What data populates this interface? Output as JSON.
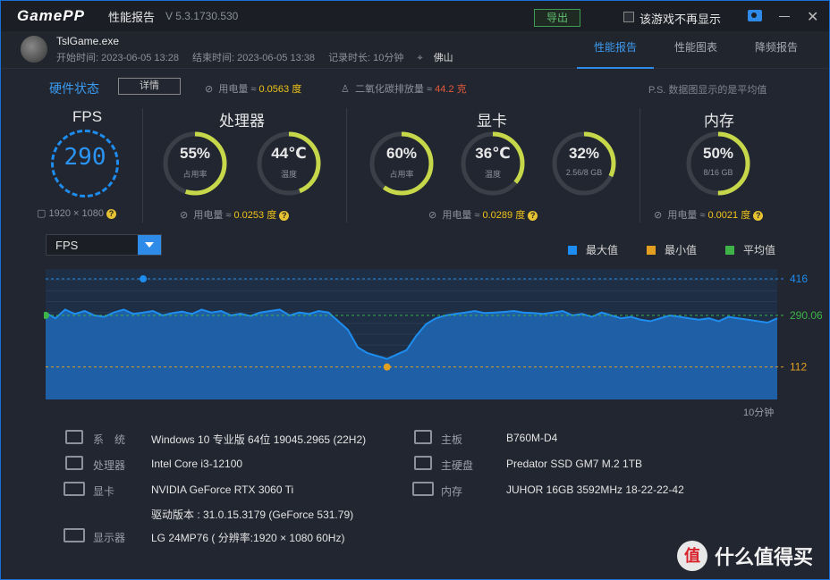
{
  "titlebar": {
    "logo": "GamePP",
    "title": "性能报告",
    "version": "V 5.3.1730.530",
    "export": "导出",
    "no_show": "该游戏不再显示"
  },
  "game": {
    "name": "TslGame.exe",
    "start": "开始时间: 2023-06-05 13:28",
    "end": "结束时间: 2023-06-05 13:38",
    "duration": "记录时长: 10分钟",
    "city": "佛山"
  },
  "tabs": [
    "性能报告",
    "性能图表",
    "降频报告"
  ],
  "hw": {
    "title": "硬件状态",
    "detail": "详情",
    "power": "用电量 ≈",
    "power_val": "0.0563 度",
    "co2": "二氧化碳排放量 ≈",
    "co2_val": "44.2 克",
    "ps": "P.S. 数据图显示的是平均值"
  },
  "fps": {
    "title": "FPS",
    "value": "290",
    "res": "1920 × 1080"
  },
  "cpu": {
    "title": "处理器",
    "usage": "55%",
    "usage_lbl": "占用率",
    "usage_frac": 0.55,
    "temp": "44℃",
    "temp_lbl": "温度",
    "temp_frac": 0.44,
    "power_lbl": "用电量 ≈",
    "power": "0.0253 度"
  },
  "gpu": {
    "title": "显卡",
    "usage": "60%",
    "usage_lbl": "占用率",
    "usage_frac": 0.6,
    "temp": "36℃",
    "temp_lbl": "温度",
    "temp_frac": 0.36,
    "vram": "32%",
    "vram_lbl": "2.56/8 GB",
    "vram_frac": 0.32,
    "power_lbl": "用电量 ≈",
    "power": "0.0289 度"
  },
  "mem": {
    "title": "内存",
    "usage": "50%",
    "usage_lbl": "8/16 GB",
    "usage_frac": 0.5,
    "power_lbl": "用电量 ≈",
    "power": "0.0021 度"
  },
  "chart": {
    "select": "FPS",
    "legend_max": "最大值",
    "legend_min": "最小值",
    "legend_avg": "平均值",
    "xlabel": "10分钟"
  },
  "chart_data": {
    "type": "area",
    "series": [
      {
        "name": "FPS",
        "values": [
          300,
          280,
          310,
          295,
          305,
          290,
          285,
          300,
          310,
          295,
          300,
          305,
          290,
          298,
          303,
          295,
          310,
          300,
          305,
          290,
          296,
          288,
          300,
          305,
          310,
          290,
          300,
          295,
          305,
          300,
          270,
          240,
          180,
          160,
          150,
          140,
          155,
          170,
          220,
          260,
          280,
          290,
          295,
          300,
          305,
          298,
          300,
          302,
          305,
          300,
          298,
          295,
          300,
          305,
          290,
          295,
          285,
          300,
          290,
          280,
          285,
          275,
          270,
          280,
          290,
          285,
          280,
          275,
          280,
          270,
          285,
          280,
          275,
          270,
          265,
          280
        ]
      }
    ],
    "max": 416,
    "min": 112,
    "avg": 290.06,
    "ylim": [
      0,
      450
    ],
    "max_label": "416",
    "min_label": "112",
    "avg_label": "290.06",
    "colors": {
      "max": "#1e8df0",
      "min": "#e3a020",
      "avg": "#3db34a"
    }
  },
  "sys": {
    "os_lbl": "系　统",
    "os": "Windows 10 专业版 64位 19045.2965 (22H2)",
    "cpu_lbl": "处理器",
    "cpu": "Intel Core i3-12100",
    "gpu_lbl": "显卡",
    "gpu": "NVIDIA GeForce RTX 3060 Ti",
    "driver": "驱动版本 : 31.0.15.3179 (GeForce 531.79)",
    "mon_lbl": "显示器",
    "mon": "LG 24MP76 ( 分辨率:1920 × 1080 60Hz)",
    "mb_lbl": "主板",
    "mb": "B760M-D4",
    "disk_lbl": "主硬盘",
    "disk": "Predator SSD GM7 M.2 1TB",
    "ram_lbl": "内存",
    "ram": "JUHOR 16GB 3592MHz 18-22-22-42"
  },
  "watermark": {
    "badge": "值",
    "text": "什么值得买"
  }
}
